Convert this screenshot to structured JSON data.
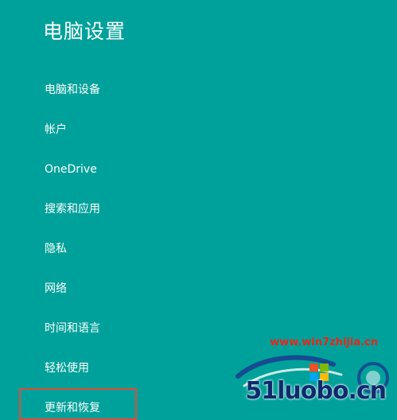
{
  "page": {
    "title": "电脑设置"
  },
  "nav": {
    "items": [
      {
        "label": "电脑和设备"
      },
      {
        "label": "帐户"
      },
      {
        "label": "OneDrive"
      },
      {
        "label": "搜索和应用"
      },
      {
        "label": "隐私"
      },
      {
        "label": "网络"
      },
      {
        "label": "时间和语言"
      },
      {
        "label": "轻松使用"
      },
      {
        "label": "更新和恢复"
      }
    ],
    "highlighted_index": 8
  },
  "watermark": {
    "url": "www.win7zhijia.cn",
    "site": "51luobo.cn"
  },
  "colors": {
    "background": "#00a19a",
    "text": "#ffffff",
    "highlight": "#e04a3a",
    "watermark_red": "#e8261b",
    "watermark_blue": "#0f2b6e"
  }
}
